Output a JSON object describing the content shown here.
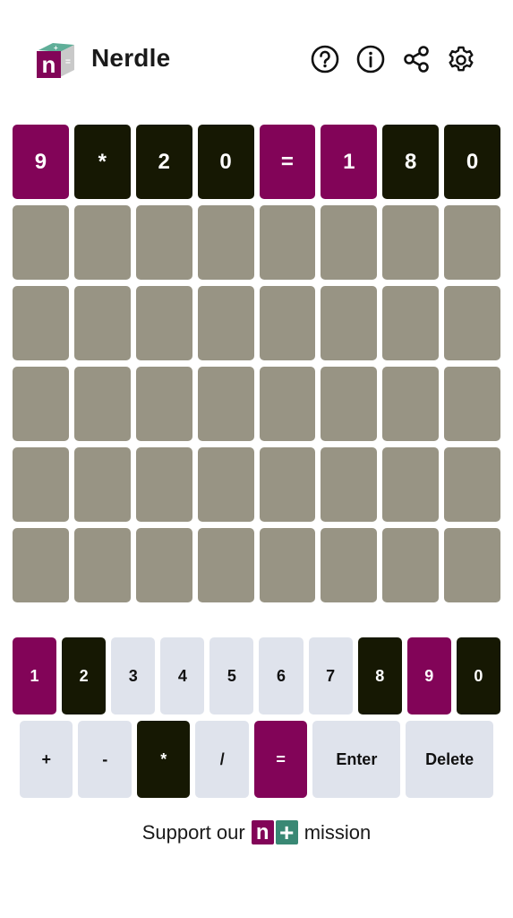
{
  "app": {
    "title": "Nerdle",
    "logo_letter": "n",
    "header_icons": [
      "help-icon",
      "info-icon",
      "share-icon",
      "settings-icon"
    ]
  },
  "colors": {
    "correct": "#820458",
    "absent": "#161803",
    "empty": "#989484",
    "key_default": "#dfe3ec",
    "logo_green": "#398874"
  },
  "board": {
    "rows": [
      [
        {
          "v": "9",
          "s": "correct"
        },
        {
          "v": "*",
          "s": "absent"
        },
        {
          "v": "2",
          "s": "absent"
        },
        {
          "v": "0",
          "s": "absent"
        },
        {
          "v": "=",
          "s": "correct"
        },
        {
          "v": "1",
          "s": "correct"
        },
        {
          "v": "8",
          "s": "absent"
        },
        {
          "v": "0",
          "s": "absent"
        }
      ],
      [
        {
          "v": "",
          "s": "empty"
        },
        {
          "v": "",
          "s": "empty"
        },
        {
          "v": "",
          "s": "empty"
        },
        {
          "v": "",
          "s": "empty"
        },
        {
          "v": "",
          "s": "empty"
        },
        {
          "v": "",
          "s": "empty"
        },
        {
          "v": "",
          "s": "empty"
        },
        {
          "v": "",
          "s": "empty"
        }
      ],
      [
        {
          "v": "",
          "s": "empty"
        },
        {
          "v": "",
          "s": "empty"
        },
        {
          "v": "",
          "s": "empty"
        },
        {
          "v": "",
          "s": "empty"
        },
        {
          "v": "",
          "s": "empty"
        },
        {
          "v": "",
          "s": "empty"
        },
        {
          "v": "",
          "s": "empty"
        },
        {
          "v": "",
          "s": "empty"
        }
      ],
      [
        {
          "v": "",
          "s": "empty"
        },
        {
          "v": "",
          "s": "empty"
        },
        {
          "v": "",
          "s": "empty"
        },
        {
          "v": "",
          "s": "empty"
        },
        {
          "v": "",
          "s": "empty"
        },
        {
          "v": "",
          "s": "empty"
        },
        {
          "v": "",
          "s": "empty"
        },
        {
          "v": "",
          "s": "empty"
        }
      ],
      [
        {
          "v": "",
          "s": "empty"
        },
        {
          "v": "",
          "s": "empty"
        },
        {
          "v": "",
          "s": "empty"
        },
        {
          "v": "",
          "s": "empty"
        },
        {
          "v": "",
          "s": "empty"
        },
        {
          "v": "",
          "s": "empty"
        },
        {
          "v": "",
          "s": "empty"
        },
        {
          "v": "",
          "s": "empty"
        }
      ],
      [
        {
          "v": "",
          "s": "empty"
        },
        {
          "v": "",
          "s": "empty"
        },
        {
          "v": "",
          "s": "empty"
        },
        {
          "v": "",
          "s": "empty"
        },
        {
          "v": "",
          "s": "empty"
        },
        {
          "v": "",
          "s": "empty"
        },
        {
          "v": "",
          "s": "empty"
        },
        {
          "v": "",
          "s": "empty"
        }
      ]
    ]
  },
  "keyboard": {
    "row1": [
      {
        "label": "1",
        "s": "correct"
      },
      {
        "label": "2",
        "s": "absent"
      },
      {
        "label": "3",
        "s": "default"
      },
      {
        "label": "4",
        "s": "default"
      },
      {
        "label": "5",
        "s": "default"
      },
      {
        "label": "6",
        "s": "default"
      },
      {
        "label": "7",
        "s": "default"
      },
      {
        "label": "8",
        "s": "absent"
      },
      {
        "label": "9",
        "s": "correct"
      },
      {
        "label": "0",
        "s": "absent"
      }
    ],
    "row2": [
      {
        "label": "+",
        "s": "default",
        "kind": "op"
      },
      {
        "label": "-",
        "s": "default",
        "kind": "op"
      },
      {
        "label": "*",
        "s": "absent",
        "kind": "op"
      },
      {
        "label": "/",
        "s": "default",
        "kind": "op"
      },
      {
        "label": "=",
        "s": "correct",
        "kind": "op"
      },
      {
        "label": "Enter",
        "s": "default",
        "kind": "enter"
      },
      {
        "label": "Delete",
        "s": "default",
        "kind": "delete"
      }
    ]
  },
  "footer": {
    "prefix": "Support our",
    "logo_n": "n",
    "logo_plus": "+",
    "suffix": "mission"
  }
}
